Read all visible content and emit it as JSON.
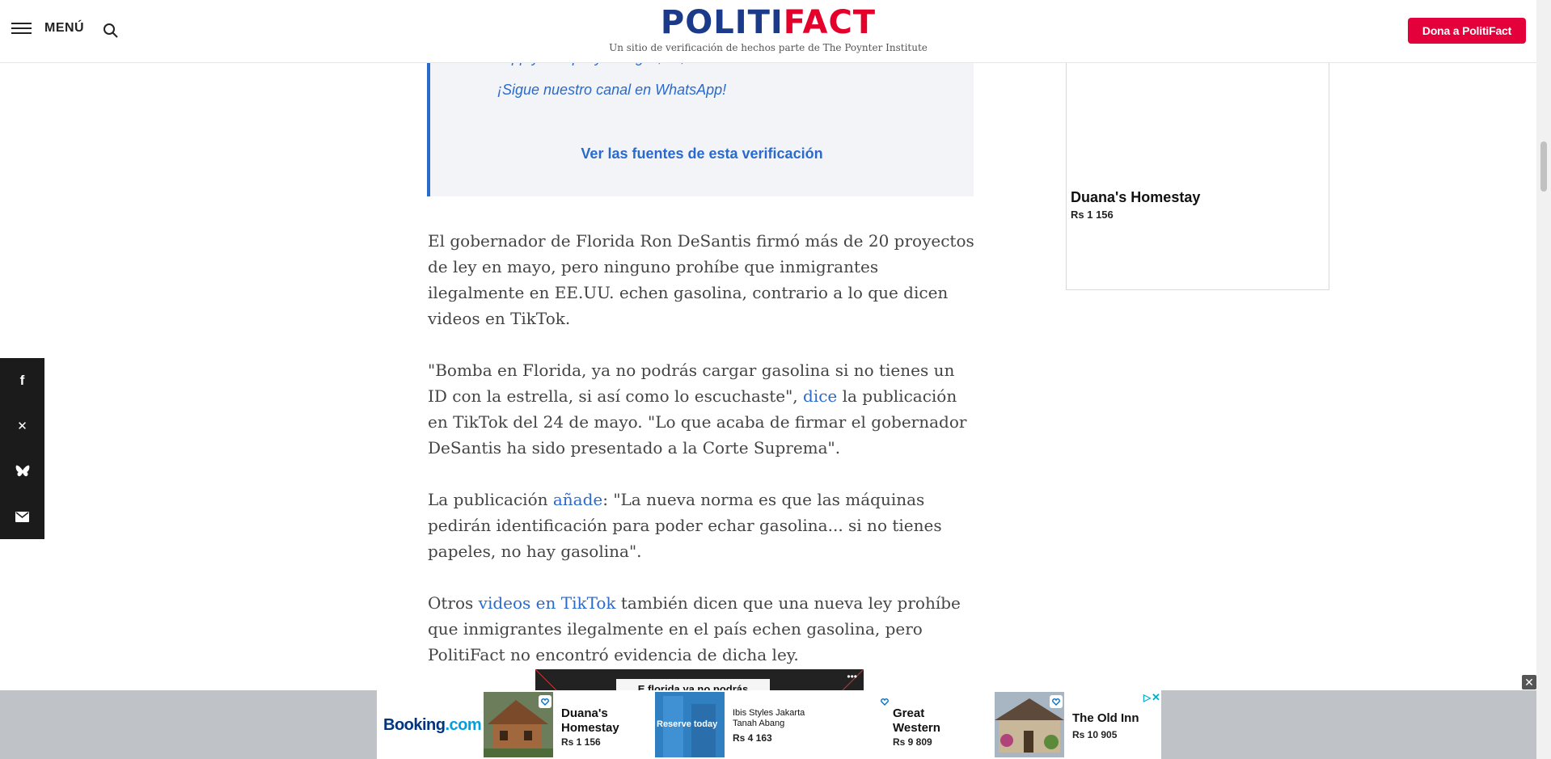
{
  "header": {
    "menu_label": "MENÚ",
    "logo_part1": "POLITI",
    "logo_part2": "FACT",
    "tagline": "Un sitio de verificación de hechos parte de The Poynter Institute",
    "donate_label": "Dona a PolitiFact"
  },
  "share": {
    "items": [
      {
        "icon": "facebook-icon",
        "glyph": "f"
      },
      {
        "icon": "x-icon",
        "glyph": "✕"
      },
      {
        "icon": "bluesky-icon",
        "glyph": "🦋"
      },
      {
        "icon": "email-icon",
        "glyph": "✉"
      }
    ]
  },
  "callout": {
    "partial_text": "…pp y…  …p…y…  …g…, …,…",
    "whatsapp_text": "¡Sigue nuestro canal en WhatsApp!",
    "sources_link": "Ver las fuentes de esta verificación"
  },
  "article": {
    "p1": "El gobernador de Florida Ron DeSantis firmó más de 20 proyectos de ley en mayo, pero ninguno prohíbe que inmigrantes ilegalmente en EE.UU. echen gasolina, contrario a lo que dicen videos en TikTok.",
    "p2_before": "\"Bomba en Florida, ya no podrás cargar gasolina si no tienes un ID con la estrella, si así como  lo escuchaste\", ",
    "p2_link": "dice",
    "p2_after": " la publicación en TikTok del 24 de mayo. \"Lo que acaba de firmar el gobernador DeSantis ha sido presentado a la Corte Suprema\".",
    "p3_before": "La publicación ",
    "p3_link": "añade",
    "p3_after": ": \"La nueva norma es que las máquinas pedirán identificación para poder echar gasolina... si no tienes papeles, no hay gasolina\".",
    "p4_before": "Otros ",
    "p4_link": "videos en TikTok",
    "p4_after": " también dicen que una nueva ley prohíbe que inmigrantes ilegalmente en el país echen gasolina, pero PolitiFact no encontró evidencia de dicha ley.",
    "embed_caption": "E florida ya no podrás"
  },
  "side_ad": {
    "name": "Duana's Homestay",
    "price": "Rs 1 156"
  },
  "bottom_ad": {
    "brand": "Booking",
    "brand_suffix": ".com",
    "reserve_label": "Reserve today",
    "cards": [
      {
        "title": "Duana's Homestay",
        "price": "Rs 1 156"
      },
      {
        "title": "Ibis Styles Jakarta Tanah Abang",
        "price": "Rs 4 163"
      },
      {
        "title": "Great Western",
        "price": "Rs 9 809"
      },
      {
        "title": "The Old Inn",
        "price": "Rs 10 905"
      }
    ],
    "close_glyph": "✕",
    "adchoices_glyph": "▷",
    "adx_glyph": "✕"
  }
}
